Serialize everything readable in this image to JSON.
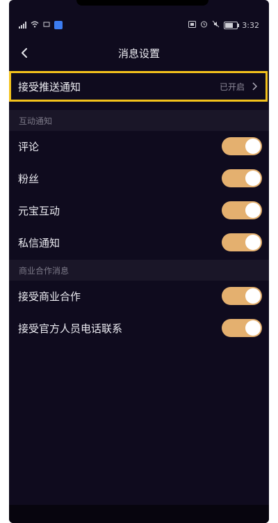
{
  "status_bar": {
    "time": "3:32",
    "battery_icon": "battery-icon"
  },
  "nav": {
    "title": "消息设置",
    "back_glyph": "‹"
  },
  "push": {
    "label": "接受推送通知",
    "status": "已开启",
    "chevron": "›"
  },
  "sections": [
    {
      "header": "互动通知",
      "items": [
        {
          "label": "评论",
          "enabled": true
        },
        {
          "label": "粉丝",
          "enabled": true
        },
        {
          "label": "元宝互动",
          "enabled": true
        },
        {
          "label": "私信通知",
          "enabled": true
        }
      ]
    },
    {
      "header": "商业合作消息",
      "items": [
        {
          "label": "接受商业合作",
          "enabled": true
        },
        {
          "label": "接受官方人员电话联系",
          "enabled": true
        }
      ]
    }
  ],
  "colors": {
    "background": "#0f0b1e",
    "highlight_border": "#f3c21c",
    "toggle_on": "#e4b06f"
  }
}
